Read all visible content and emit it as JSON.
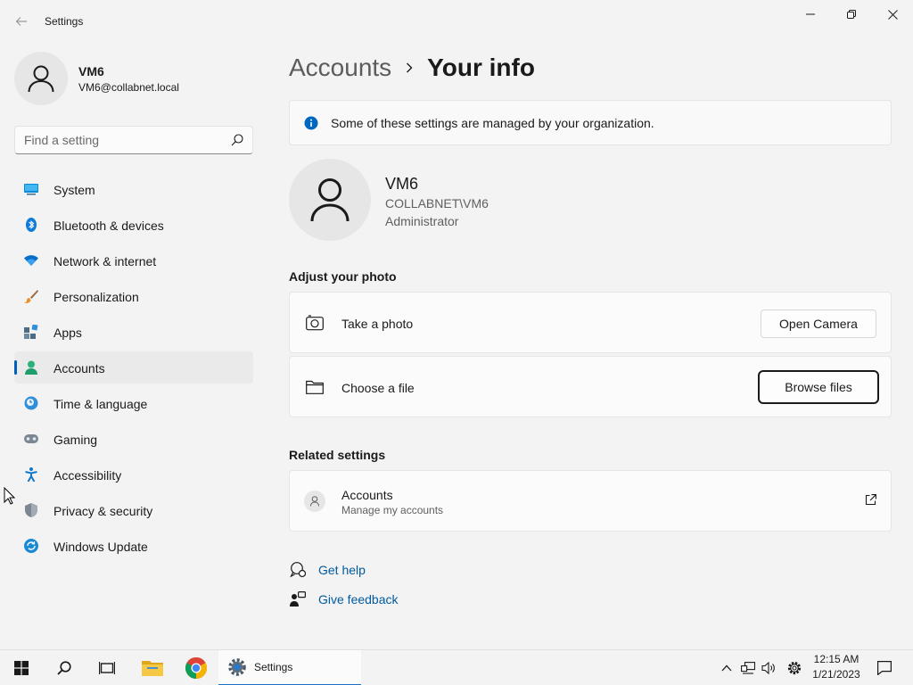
{
  "window": {
    "title": "Settings"
  },
  "profile": {
    "name": "VM6",
    "email": "VM6@collabnet.local"
  },
  "search": {
    "placeholder": "Find a setting"
  },
  "sidebar": {
    "items": [
      {
        "label": "System",
        "icon": "monitor-icon",
        "active": false
      },
      {
        "label": "Bluetooth & devices",
        "icon": "bluetooth-icon",
        "active": false
      },
      {
        "label": "Network & internet",
        "icon": "wifi-icon",
        "active": false
      },
      {
        "label": "Personalization",
        "icon": "paintbrush-icon",
        "active": false
      },
      {
        "label": "Apps",
        "icon": "apps-icon",
        "active": false
      },
      {
        "label": "Accounts",
        "icon": "person-icon",
        "active": true
      },
      {
        "label": "Time & language",
        "icon": "globe-clock-icon",
        "active": false
      },
      {
        "label": "Gaming",
        "icon": "gamepad-icon",
        "active": false
      },
      {
        "label": "Accessibility",
        "icon": "accessibility-icon",
        "active": false
      },
      {
        "label": "Privacy & security",
        "icon": "shield-icon",
        "active": false
      },
      {
        "label": "Windows Update",
        "icon": "update-icon",
        "active": false
      }
    ]
  },
  "breadcrumb": {
    "parent": "Accounts",
    "current": "Your info"
  },
  "notice": {
    "text": "Some of these settings are managed by your organization."
  },
  "user": {
    "name": "VM6",
    "domain": "COLLABNET\\VM6",
    "role": "Administrator"
  },
  "photo": {
    "section_title": "Adjust your photo",
    "take_photo_label": "Take a photo",
    "open_camera_label": "Open Camera",
    "choose_file_label": "Choose a file",
    "browse_files_label": "Browse files"
  },
  "related": {
    "section_title": "Related settings",
    "accounts_title": "Accounts",
    "accounts_subtitle": "Manage my accounts"
  },
  "help": {
    "get_help": "Get help",
    "give_feedback": "Give feedback"
  },
  "taskbar": {
    "settings_label": "Settings",
    "time": "12:15 AM",
    "date": "1/21/2023"
  },
  "colors": {
    "accent": "#005fb8",
    "link": "#005a9e",
    "info": "#0067c0"
  }
}
